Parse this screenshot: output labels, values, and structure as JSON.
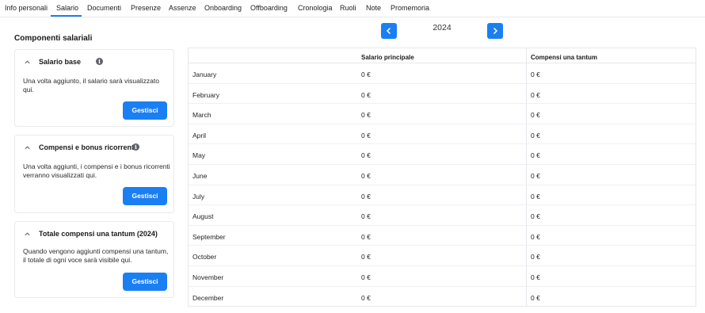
{
  "tabs": [
    {
      "label": "Info personali"
    },
    {
      "label": "Salario"
    },
    {
      "label": "Documenti"
    },
    {
      "label": "Presenze"
    },
    {
      "label": "Assenze"
    },
    {
      "label": "Onboarding"
    },
    {
      "label": "Offboarding"
    },
    {
      "label": "Cronologia"
    },
    {
      "label": "Ruoli"
    },
    {
      "label": "Note"
    },
    {
      "label": "Promemoria"
    }
  ],
  "active_tab": "Salario",
  "section_title": "Componenti salariali",
  "cards": [
    {
      "title": "Salario base",
      "info": "i",
      "description": "Una volta aggiunto, il salario sarà visualizzato qui.",
      "button": "Gestisci"
    },
    {
      "title": "Compensi e bonus ricorrenti",
      "info": "i",
      "description": "Una volta aggiunti, i compensi e i bonus ricorrenti verranno visualizzati qui.",
      "button": "Gestisci"
    },
    {
      "title": "Totale compensi una tantum (2024)",
      "description": "Quando vengono aggiunti compensi una tantum, il totale di ogni voce sarà visibile qui.",
      "button": "Gestisci"
    }
  ],
  "year_nav": {
    "year": "2024",
    "prev_icon": "chevron-left-icon",
    "next_icon": "chevron-right-icon"
  },
  "table": {
    "columns": [
      "",
      "Salario principale",
      "Compensi una tantum"
    ],
    "rows": [
      {
        "month": "January",
        "salary": "0 €",
        "one_time": "0 €"
      },
      {
        "month": "February",
        "salary": "0 €",
        "one_time": "0 €"
      },
      {
        "month": "March",
        "salary": "0 €",
        "one_time": "0 €"
      },
      {
        "month": "April",
        "salary": "0 €",
        "one_time": "0 €"
      },
      {
        "month": "May",
        "salary": "0 €",
        "one_time": "0 €"
      },
      {
        "month": "June",
        "salary": "0 €",
        "one_time": "0 €"
      },
      {
        "month": "July",
        "salary": "0 €",
        "one_time": "0 €"
      },
      {
        "month": "August",
        "salary": "0 €",
        "one_time": "0 €"
      },
      {
        "month": "September",
        "salary": "0 €",
        "one_time": "0 €"
      },
      {
        "month": "October",
        "salary": "0 €",
        "one_time": "0 €"
      },
      {
        "month": "November",
        "salary": "0 €",
        "one_time": "0 €"
      },
      {
        "month": "December",
        "salary": "0 €",
        "one_time": "0 €"
      }
    ]
  },
  "colors": {
    "accent": "#1b7ff4",
    "border": "#e6e8eb",
    "text": "#1f1f1f"
  }
}
